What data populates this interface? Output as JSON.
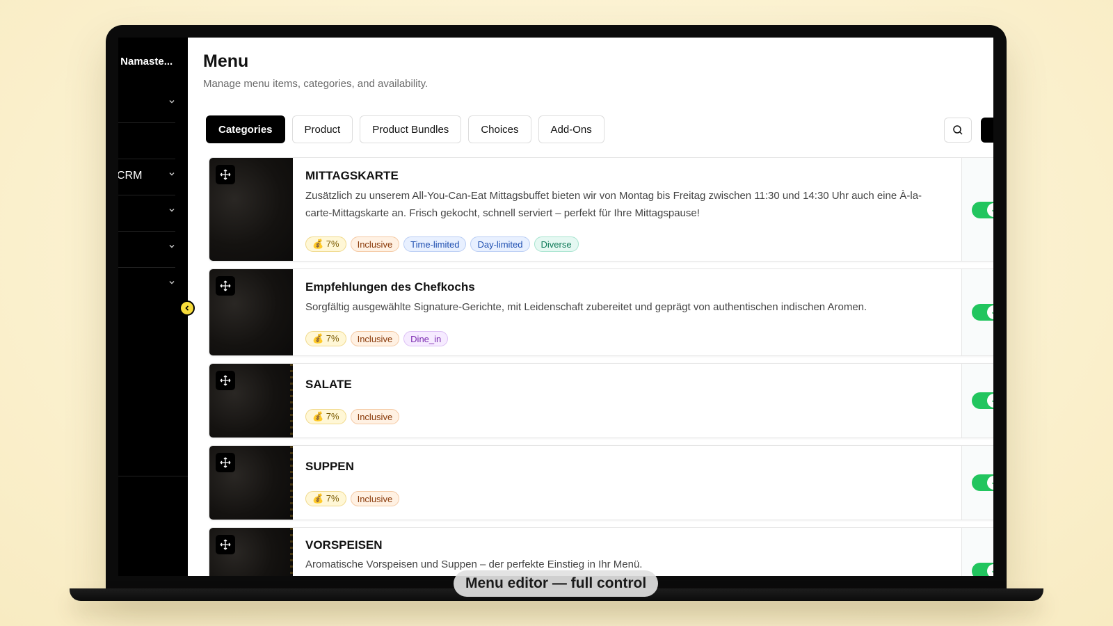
{
  "sidebar": {
    "brand": "t Namaste...",
    "items": [
      {
        "label": ""
      },
      {
        "label": ""
      },
      {
        "label": "CRM"
      },
      {
        "label": ""
      },
      {
        "label": ""
      },
      {
        "label": ""
      }
    ]
  },
  "header": {
    "title": "Menu",
    "subtitle": "Manage menu items, categories, and availability."
  },
  "tabs": [
    "Categories",
    "Product",
    "Product Bundles",
    "Choices",
    "Add-Ons"
  ],
  "active_tab": "Categories",
  "categories": [
    {
      "name": "MITTAGSKARTE",
      "description": "Zusätzlich zu unserem All-You-Can-Eat Mittagsbuffet bieten wir von Montag bis Freitag zwischen 11:30 und 14:30 Uhr auch eine À-la-carte-Mittagskarte an. Frisch gekocht, schnell serviert – perfekt für Ihre Mittagspause!",
      "badges": [
        "💰 7%",
        "Inclusive",
        "Time-limited",
        "Day-limited",
        "Diverse"
      ],
      "enabled": true
    },
    {
      "name": "Empfehlungen des Chefkochs",
      "description": "Sorgfältig ausgewählte Signature-Gerichte, mit Leidenschaft zubereitet und geprägt von authentischen indischen Aromen.",
      "badges": [
        "💰 7%",
        "Inclusive",
        "Dine_in"
      ],
      "enabled": true
    },
    {
      "name": "SALATE",
      "description": "",
      "badges": [
        "💰 7%",
        "Inclusive"
      ],
      "enabled": true
    },
    {
      "name": "SUPPEN",
      "description": "",
      "badges": [
        "💰 7%",
        "Inclusive"
      ],
      "enabled": true
    },
    {
      "name": "VORSPEISEN",
      "description": "Aromatische Vorspeisen und Suppen – der perfekte Einstieg in Ihr Menü.",
      "badges": [],
      "enabled": true
    }
  ],
  "caption": "Menu editor — full control",
  "colors": {
    "accent": "#000000",
    "toggle_on": "#22c55e",
    "collapse_button": "#f7dc3a",
    "background": "#fbf1cf"
  }
}
